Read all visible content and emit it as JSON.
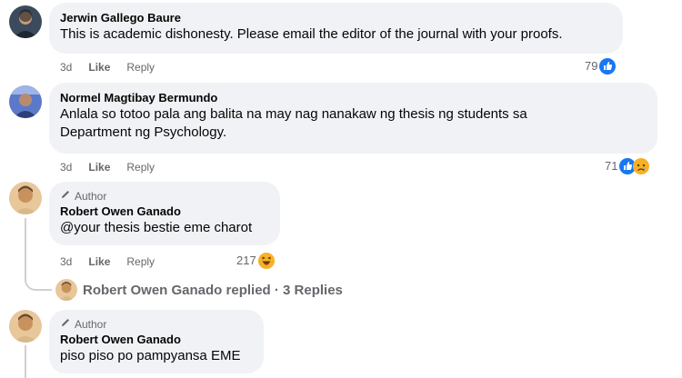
{
  "comments": [
    {
      "name": "Jerwin Gallego Baure",
      "text": "This is academic dishonesty. Please email the editor of the journal with your proofs.",
      "time": "3d",
      "like": "Like",
      "reply": "Reply",
      "reactions": "79"
    },
    {
      "name": "Normel Magtibay Bermundo",
      "text_line1": "Anlala so totoo pala ang balita na may nag nanakaw ng thesis ng students sa",
      "text_line2": "Department ng Psychology.",
      "time": "3d",
      "like": "Like",
      "reply": "Reply",
      "reactions": "71"
    },
    {
      "author_badge": "Author",
      "name": "Robert Owen Ganado",
      "text": "@your thesis bestie eme charot",
      "time": "3d",
      "like": "Like",
      "reply": "Reply",
      "reactions": "217"
    },
    {
      "author_badge": "Author",
      "name": "Robert Owen Ganado",
      "text": "piso piso po pampyansa EME"
    }
  ],
  "replies_summary": "Robert Owen Ganado replied · 3 Replies",
  "colors": {
    "bubble": "#f0f2f5",
    "like_blue": "#1877f2",
    "meta": "#65676b"
  },
  "icons": [
    "thumbs-up-icon",
    "sad-face-icon",
    "laughing-face-icon",
    "pen-icon"
  ]
}
